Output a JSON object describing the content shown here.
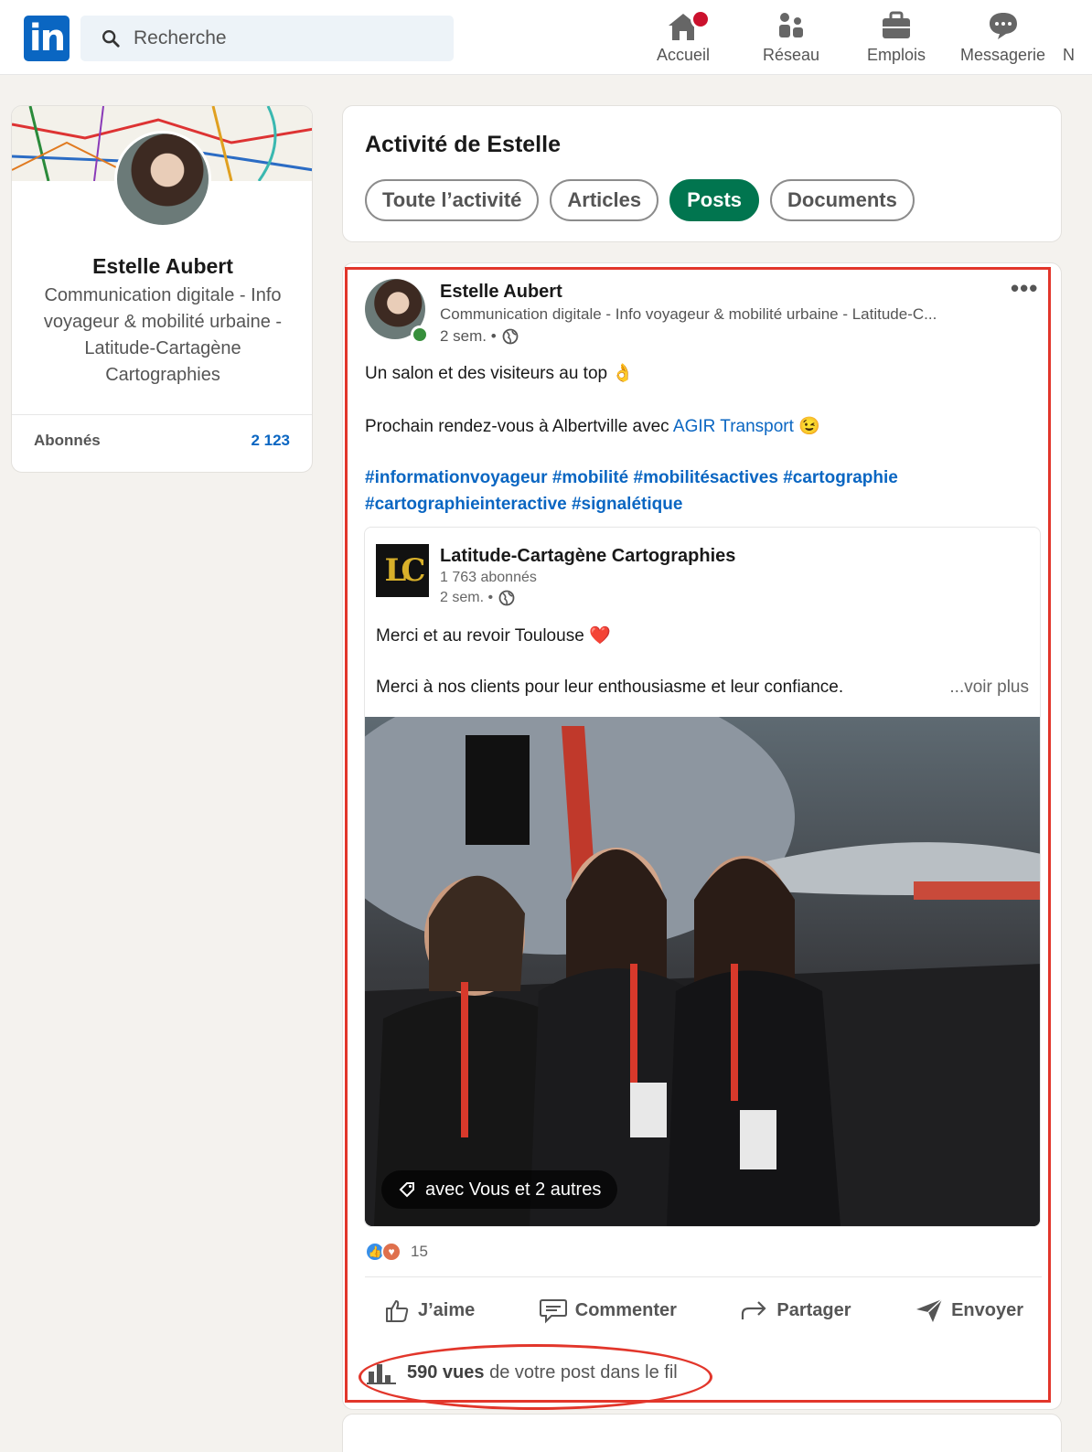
{
  "nav": {
    "search_placeholder": "Recherche",
    "items": [
      {
        "label": "Accueil",
        "icon": "home-icon"
      },
      {
        "label": "Réseau",
        "icon": "network-icon"
      },
      {
        "label": "Emplois",
        "icon": "briefcase-icon"
      },
      {
        "label": "Messagerie",
        "icon": "messaging-icon"
      },
      {
        "label": "N",
        "icon": "notifications-icon"
      }
    ],
    "logo_text": "in"
  },
  "profile": {
    "name": "Estelle Aubert",
    "headline": "Communication digitale - Info voyageur & mobilité urbaine - Latitude-Cartagène Cartographies",
    "followers_label": "Abonnés",
    "followers_count": "2 123"
  },
  "activity": {
    "title": "Activité de Estelle",
    "filters": [
      "Toute l’activité",
      "Articles",
      "Posts",
      "Documents"
    ],
    "active_filter": "Posts"
  },
  "post": {
    "author": "Estelle Aubert",
    "headline": "Communication digitale - Info voyageur & mobilité urbaine - Latitude-C...",
    "time": "2 sem. •",
    "more": "•••",
    "line1": "Un salon et des visiteurs au top 👌",
    "line2_prefix": "Prochain rendez-vous à Albertville avec ",
    "line2_link": "AGIR Transport",
    "line2_suffix": " 😉",
    "hashtags1": "#informationvoyageur #mobilité #mobilitésactives #cartographie",
    "hashtags2": "#cartographieinteractive #signalétique",
    "reshare": {
      "logo_text": "LC",
      "company": "Latitude-Cartagène Cartographies",
      "followers": "1 763 abonnés",
      "time": "2 sem. •",
      "line1": "Merci et au revoir Toulouse ❤️",
      "line2": "Merci à nos clients pour leur enthousiasme et leur confiance.",
      "see_more": "...voir plus",
      "tag_text": "avec Vous et 2 autres"
    },
    "reaction_count": "15",
    "actions": [
      "J’aime",
      "Commenter",
      "Partager",
      "Envoyer"
    ],
    "views_strong": "590 vues",
    "views_rest": " de votre post dans le fil"
  },
  "colors": {
    "brand": "#0a66c2",
    "active_pill": "#01754f",
    "annotation": "#e2362b"
  }
}
